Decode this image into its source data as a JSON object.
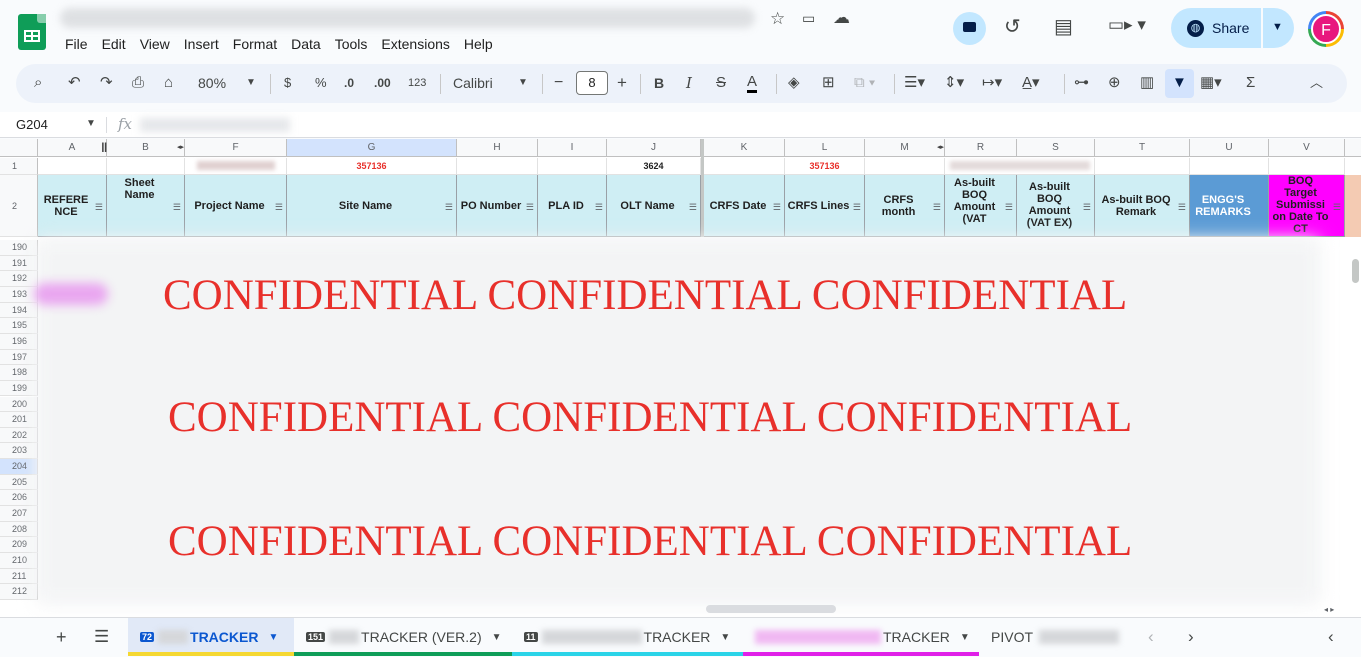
{
  "window": {
    "menus": [
      "File",
      "Edit",
      "View",
      "Insert",
      "Format",
      "Data",
      "Tools",
      "Extensions",
      "Help"
    ],
    "share_label": "Share",
    "avatar_initial": "F",
    "icons": [
      "sheets-logo-icon",
      "star-icon",
      "move-folder-icon",
      "cloud-status-icon",
      "meet-present-icon",
      "history-icon",
      "comments-icon",
      "meet-icon",
      "globe-icon",
      "avatar"
    ]
  },
  "toolbar": {
    "zoom": "80%",
    "currency": "$",
    "percent": "%",
    "dec_decrease": ".0",
    "dec_increase": ".00",
    "format_123": "123",
    "font": "Calibri",
    "font_size": "8",
    "minus": "−",
    "plus": "+",
    "bold": "B",
    "italic": "I",
    "sigma": "Σ"
  },
  "formula_bar": {
    "cell_ref": "G204",
    "fx": "fx"
  },
  "columns": [
    {
      "letter": "A"
    },
    {
      "letter": "B"
    },
    {
      "letter": "F"
    },
    {
      "letter": "G"
    },
    {
      "letter": "H"
    },
    {
      "letter": "I"
    },
    {
      "letter": "J"
    },
    {
      "letter": "K"
    },
    {
      "letter": "L"
    },
    {
      "letter": "M"
    },
    {
      "letter": "R"
    },
    {
      "letter": "S"
    },
    {
      "letter": "T"
    },
    {
      "letter": "U"
    },
    {
      "letter": "V"
    }
  ],
  "row1": {
    "G": "357136",
    "J": "3624",
    "L": "357136"
  },
  "headers": {
    "A": "REFERE NCE",
    "B": "Sheet Name",
    "F": "Project Name",
    "G": "Site Name",
    "H": "PO Number",
    "I": "PLA ID",
    "J": "OLT Name",
    "K": "CRFS Date",
    "L": "CRFS Lines",
    "M": "CRFS month",
    "R": "As-built BOQ Amount (VAT",
    "S": "As-built BOQ Amount (VAT EX)",
    "T": "As-built BOQ Remark",
    "U": "ENGG'S REMARKS",
    "V": "BOQ Target Submissi on Date To CT"
  },
  "row_numbers": [
    "1",
    "2",
    "190",
    "191",
    "192",
    "193",
    "194",
    "195",
    "196",
    "197",
    "198",
    "199",
    "200",
    "201",
    "202",
    "203",
    "204",
    "205",
    "206",
    "207",
    "208",
    "209",
    "210",
    "211",
    "212"
  ],
  "watermark": {
    "line1": "CONFIDENTIAL  CONFIDENTIAL CONFIDENTIAL",
    "line2": "CONFIDENTIAL CONFIDENTIAL CONFIDENTIAL",
    "line3": "CONFIDENTIAL CONFIDENTIAL CONFIDENTIAL",
    "color": "#e8302b"
  },
  "sheets": [
    {
      "badge": "72",
      "name": "TRACKER",
      "active": true,
      "underline": "#f5d832"
    },
    {
      "badge": "151",
      "name": "TRACKER (VER.2)",
      "active": false,
      "underline": "#0f9d58"
    },
    {
      "badge": "11",
      "name": "TRACKER",
      "active": false,
      "underline": "#2ad4e8"
    },
    {
      "badge": "",
      "name": "TRACKER",
      "active": false,
      "underline": "#e020e8"
    },
    {
      "badge": "",
      "name": "PIVOT",
      "active": false,
      "underline": ""
    }
  ],
  "colors": {
    "header_fill": "#cfeef4",
    "engg_remarks_fill": "#5b9bd5",
    "boq_target_fill": "#ff00ff",
    "row1_value_color": "#e8302b"
  }
}
